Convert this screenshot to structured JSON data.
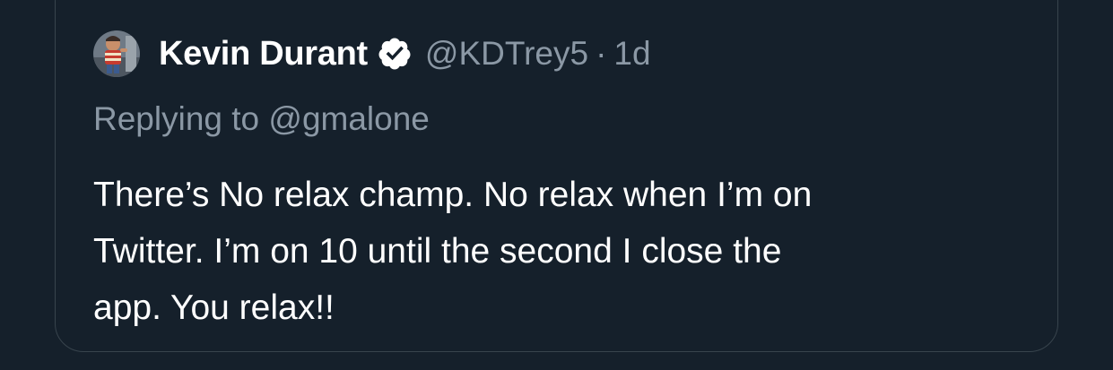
{
  "tweet": {
    "author": {
      "display_name": "Kevin Durant",
      "handle": "@KDTrey5",
      "verified": true,
      "avatar_icon": "user-avatar"
    },
    "separator": "·",
    "timestamp": "1d",
    "reply_prefix": "Replying to",
    "reply_to": "@gmalone",
    "text_lines": [
      "There’s No relax champ. No relax when I’m on",
      "Twitter. I’m on 10 until the second I close the",
      "app. You relax!!"
    ]
  },
  "colors": {
    "background": "#15202b",
    "border": "#38444d",
    "primary_text": "#ffffff",
    "secondary_text": "#8b98a5",
    "verified_badge": "#ffffff"
  },
  "icons": {
    "verified": "verified-badge-icon"
  }
}
